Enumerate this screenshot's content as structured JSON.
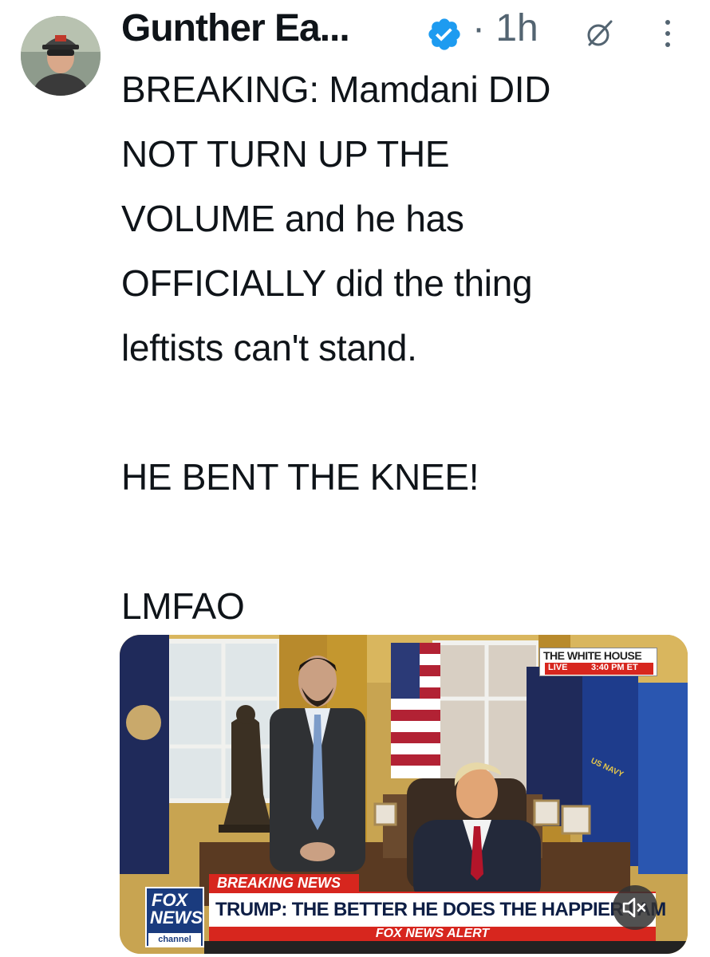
{
  "tweet": {
    "author_name": "Gunther Ea...",
    "separator": "·",
    "time": "1h",
    "lines": [
      "BREAKING: Mamdani DID",
      "NOT TURN UP THE",
      "VOLUME and he has",
      "OFFICIALLY did the thing",
      "leftists can't stand.",
      "",
      "HE BENT THE KNEE!",
      "",
      "LMFAO"
    ]
  },
  "media": {
    "bug_title": "THE WHITE HOUSE",
    "bug_live": "LIVE",
    "bug_time": "3:40 PM ET",
    "flag_text": "US NAVY",
    "breaking_label": "BREAKING NEWS",
    "headline": "TRUMP: THE BETTER HE DOES THE HAPPIER I AM",
    "alert_label": "FOX NEWS ALERT",
    "logo_top": "FOX",
    "logo_bottom": "NEWS",
    "logo_channel": "channel"
  },
  "colors": {
    "verified_blue": "#1d9bf0",
    "fox_red": "#d7261e",
    "fox_blue": "#1a3b7e"
  },
  "icons": {
    "verified": "verified-badge-icon",
    "grok": "grok-icon",
    "more": "more-vertical-icon",
    "mute": "speaker-muted-icon"
  }
}
